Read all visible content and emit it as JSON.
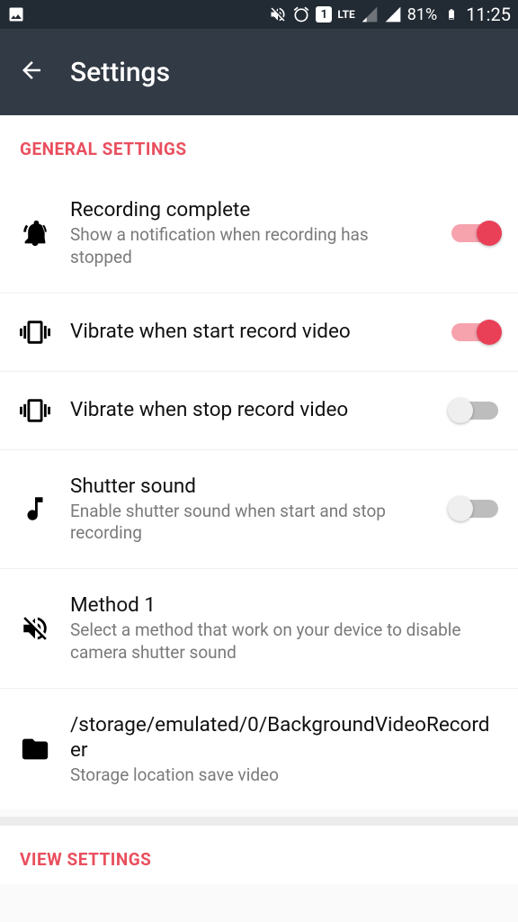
{
  "status": {
    "battery_pct": "81%",
    "time": "11:25",
    "sim": "1",
    "lte": "LTE"
  },
  "header": {
    "title": "Settings"
  },
  "sections": {
    "general_label": "GENERAL SETTINGS",
    "view_label": "VIEW SETTINGS"
  },
  "rows": {
    "recording_complete": {
      "title": "Recording complete",
      "subtitle": "Show a notification when recording has stopped",
      "on": true
    },
    "vibrate_start": {
      "title": "Vibrate when start record video",
      "on": true
    },
    "vibrate_stop": {
      "title": "Vibrate when stop record video",
      "on": false
    },
    "shutter_sound": {
      "title": "Shutter sound",
      "subtitle": "Enable shutter sound when start and stop recording",
      "on": false
    },
    "method": {
      "title": "Method 1",
      "subtitle": "Select a method that work on your device to disable camera shutter sound"
    },
    "storage": {
      "title": "/storage/emulated/0/BackgroundVideoRecorder",
      "subtitle": "Storage location save video"
    }
  }
}
